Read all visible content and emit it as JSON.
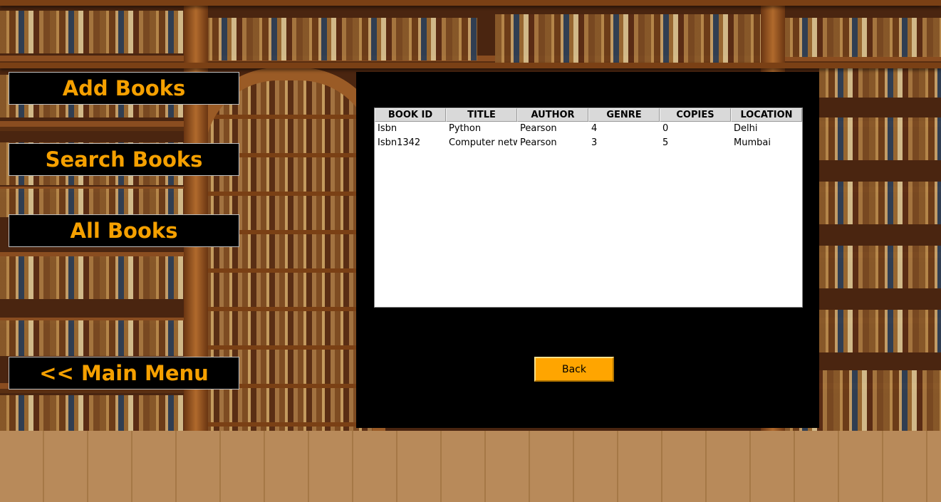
{
  "menu": {
    "add_books": "Add Books",
    "search_books": "Search Books",
    "all_books": "All Books",
    "main_menu": "<< Main Menu"
  },
  "table": {
    "columns": [
      "BOOK ID",
      "TITLE",
      "AUTHOR",
      "GENRE",
      "COPIES",
      "LOCATION"
    ],
    "rows": [
      [
        "Isbn",
        "Python",
        "Pearson",
        "4",
        "0",
        "Delhi"
      ],
      [
        "Isbn1342",
        "Computer networks",
        "Pearson",
        "3",
        "5",
        "Mumbai"
      ]
    ]
  },
  "back_label": "Back",
  "colors": {
    "accent": "#ffa500",
    "menu_text": "#f5a000",
    "panel_bg": "#000000"
  }
}
